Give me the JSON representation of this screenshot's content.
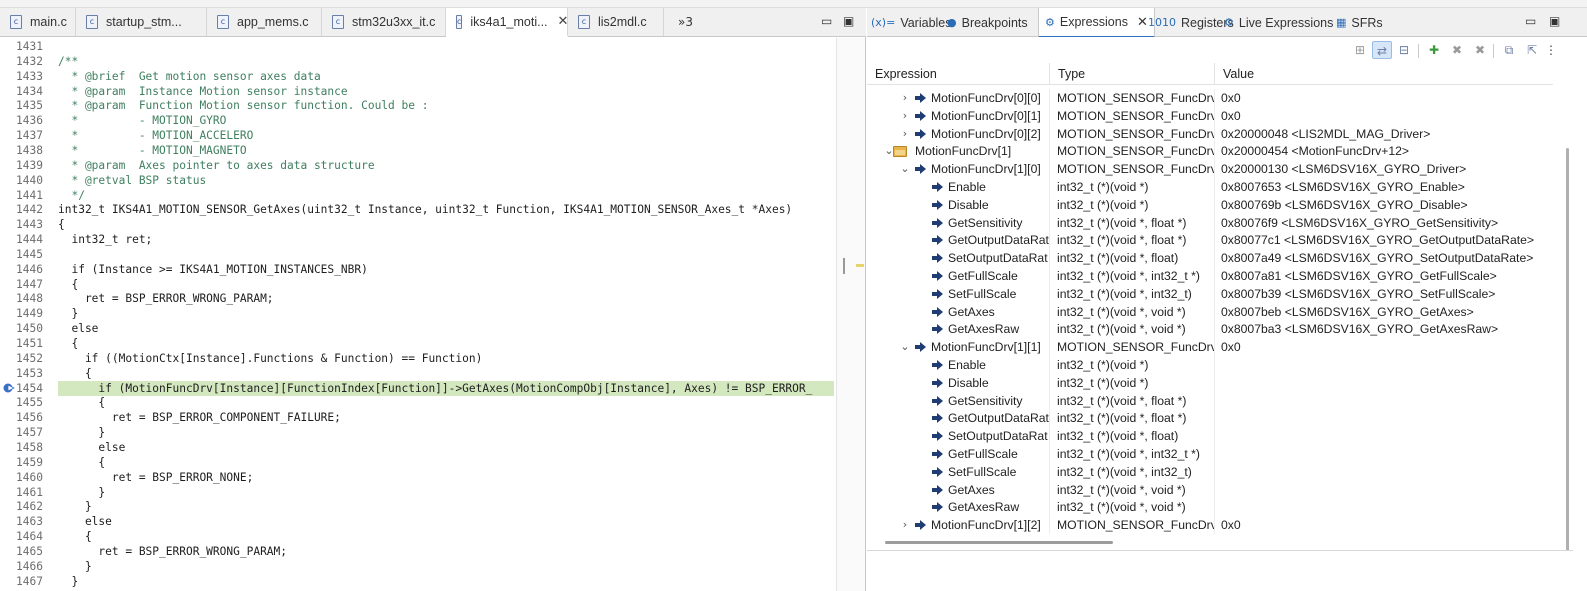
{
  "editor": {
    "tabs": [
      {
        "label": "main.c",
        "active": false
      },
      {
        "label": "startup_stm...",
        "active": false
      },
      {
        "label": "app_mems.c",
        "active": false
      },
      {
        "label": "stm32u3xx_it.c",
        "active": false
      },
      {
        "label": "iks4a1_moti...",
        "active": true,
        "close": "✕"
      },
      {
        "label": "lis2mdl.c",
        "active": false
      }
    ],
    "overflow_label": "»3",
    "minimize": "▭",
    "maximize": "▣",
    "current_line": "1454",
    "lines": [
      {
        "n": "1431",
        "text": "",
        "kind": "code"
      },
      {
        "n": "1432",
        "text": "/**",
        "kind": "comment"
      },
      {
        "n": "1433",
        "text": "  * @brief  Get motion sensor axes data",
        "kind": "comment"
      },
      {
        "n": "1434",
        "text": "  * @param  Instance Motion sensor instance",
        "kind": "comment"
      },
      {
        "n": "1435",
        "text": "  * @param  Function Motion sensor function. Could be :",
        "kind": "comment"
      },
      {
        "n": "1436",
        "text": "  *         - MOTION_GYRO",
        "kind": "comment"
      },
      {
        "n": "1437",
        "text": "  *         - MOTION_ACCELERO",
        "kind": "comment"
      },
      {
        "n": "1438",
        "text": "  *         - MOTION_MAGNETO",
        "kind": "comment"
      },
      {
        "n": "1439",
        "text": "  * @param  Axes pointer to axes data structure",
        "kind": "comment"
      },
      {
        "n": "1440",
        "text": "  * @retval BSP status",
        "kind": "comment"
      },
      {
        "n": "1441",
        "text": "  */",
        "kind": "comment"
      },
      {
        "n": "1442",
        "text": "int32_t IKS4A1_MOTION_SENSOR_GetAxes(uint32_t Instance, uint32_t Function, IKS4A1_MOTION_SENSOR_Axes_t *Axes)",
        "kind": "code"
      },
      {
        "n": "1443",
        "text": "{",
        "kind": "code"
      },
      {
        "n": "1444",
        "text": "  int32_t ret;",
        "kind": "code"
      },
      {
        "n": "1445",
        "text": "",
        "kind": "code"
      },
      {
        "n": "1446",
        "text": "  if (Instance >= IKS4A1_MOTION_INSTANCES_NBR)",
        "kind": "code"
      },
      {
        "n": "1447",
        "text": "  {",
        "kind": "code"
      },
      {
        "n": "1448",
        "text": "    ret = BSP_ERROR_WRONG_PARAM;",
        "kind": "code"
      },
      {
        "n": "1449",
        "text": "  }",
        "kind": "code"
      },
      {
        "n": "1450",
        "text": "  else",
        "kind": "code"
      },
      {
        "n": "1451",
        "text": "  {",
        "kind": "code"
      },
      {
        "n": "1452",
        "text": "    if ((MotionCtx[Instance].Functions & Function) == Function)",
        "kind": "code"
      },
      {
        "n": "1453",
        "text": "    {",
        "kind": "code"
      },
      {
        "n": "1454",
        "text": "      if (MotionFuncDrv[Instance][FunctionIndex[Function]]->GetAxes(MotionCompObj[Instance], Axes) != BSP_ERROR_",
        "kind": "current"
      },
      {
        "n": "1455",
        "text": "      {",
        "kind": "code"
      },
      {
        "n": "1456",
        "text": "        ret = BSP_ERROR_COMPONENT_FAILURE;",
        "kind": "code"
      },
      {
        "n": "1457",
        "text": "      }",
        "kind": "code"
      },
      {
        "n": "1458",
        "text": "      else",
        "kind": "code"
      },
      {
        "n": "1459",
        "text": "      {",
        "kind": "code"
      },
      {
        "n": "1460",
        "text": "        ret = BSP_ERROR_NONE;",
        "kind": "code"
      },
      {
        "n": "1461",
        "text": "      }",
        "kind": "code"
      },
      {
        "n": "1462",
        "text": "    }",
        "kind": "code"
      },
      {
        "n": "1463",
        "text": "    else",
        "kind": "code"
      },
      {
        "n": "1464",
        "text": "    {",
        "kind": "code"
      },
      {
        "n": "1465",
        "text": "      ret = BSP_ERROR_WRONG_PARAM;",
        "kind": "code"
      },
      {
        "n": "1466",
        "text": "    }",
        "kind": "code"
      },
      {
        "n": "1467",
        "text": "  }",
        "kind": "code"
      }
    ]
  },
  "views": {
    "tabs": [
      {
        "icon": "(x)=",
        "label": "Variables"
      },
      {
        "icon": "●",
        "label": "Breakpoints"
      },
      {
        "icon": "⚙",
        "label": "Expressions",
        "active": true,
        "close": "✕"
      },
      {
        "icon": "1010",
        "label": "Registers"
      },
      {
        "icon": "⚙",
        "label": "Live Expressions"
      },
      {
        "icon": "▦",
        "label": "SFRs"
      }
    ],
    "minimize": "▭",
    "maximize": "▣"
  },
  "expressions": {
    "columns": [
      "Expression",
      "Type",
      "Value"
    ],
    "rows": [
      {
        "depth": 1,
        "twisty": "›",
        "icon": "arrow",
        "name": "MotionFuncDrv[0][0]",
        "type": "MOTION_SENSOR_FuncDrv_...",
        "value": "0x0"
      },
      {
        "depth": 1,
        "twisty": "›",
        "icon": "arrow",
        "name": "MotionFuncDrv[0][1]",
        "type": "MOTION_SENSOR_FuncDrv_...",
        "value": "0x0"
      },
      {
        "depth": 1,
        "twisty": "›",
        "icon": "arrow",
        "name": "MotionFuncDrv[0][2]",
        "type": "MOTION_SENSOR_FuncDrv_...",
        "value": "0x20000048 <LIS2MDL_MAG_Driver>"
      },
      {
        "depth": 0,
        "twisty": "⌄",
        "icon": "folder",
        "name": "MotionFuncDrv[1]",
        "type": "MOTION_SENSOR_FuncDrv_...",
        "value": "0x20000454 <MotionFuncDrv+12>"
      },
      {
        "depth": 1,
        "twisty": "⌄",
        "icon": "arrow",
        "name": "MotionFuncDrv[1][0]",
        "type": "MOTION_SENSOR_FuncDrv_...",
        "value": "0x20000130 <LSM6DSV16X_GYRO_Driver>"
      },
      {
        "depth": 2,
        "twisty": "",
        "icon": "arrow",
        "name": "Enable",
        "type": "int32_t (*)(void *)",
        "value": "0x8007653 <LSM6DSV16X_GYRO_Enable>"
      },
      {
        "depth": 2,
        "twisty": "",
        "icon": "arrow",
        "name": "Disable",
        "type": "int32_t (*)(void *)",
        "value": "0x800769b <LSM6DSV16X_GYRO_Disable>"
      },
      {
        "depth": 2,
        "twisty": "",
        "icon": "arrow",
        "name": "GetSensitivity",
        "type": "int32_t (*)(void *, float *)",
        "value": "0x80076f9 <LSM6DSV16X_GYRO_GetSensitivity>"
      },
      {
        "depth": 2,
        "twisty": "",
        "icon": "arrow",
        "name": "GetOutputDataRat",
        "type": "int32_t (*)(void *, float *)",
        "value": "0x80077c1 <LSM6DSV16X_GYRO_GetOutputDataRate>"
      },
      {
        "depth": 2,
        "twisty": "",
        "icon": "arrow",
        "name": "SetOutputDataRat",
        "type": "int32_t (*)(void *, float)",
        "value": "0x8007a49 <LSM6DSV16X_GYRO_SetOutputDataRate>"
      },
      {
        "depth": 2,
        "twisty": "",
        "icon": "arrow",
        "name": "GetFullScale",
        "type": "int32_t (*)(void *, int32_t *)",
        "value": "0x8007a81 <LSM6DSV16X_GYRO_GetFullScale>"
      },
      {
        "depth": 2,
        "twisty": "",
        "icon": "arrow",
        "name": "SetFullScale",
        "type": "int32_t (*)(void *, int32_t)",
        "value": "0x8007b39 <LSM6DSV16X_GYRO_SetFullScale>"
      },
      {
        "depth": 2,
        "twisty": "",
        "icon": "arrow",
        "name": "GetAxes",
        "type": "int32_t (*)(void *, void *)",
        "value": "0x8007beb <LSM6DSV16X_GYRO_GetAxes>"
      },
      {
        "depth": 2,
        "twisty": "",
        "icon": "arrow",
        "name": "GetAxesRaw",
        "type": "int32_t (*)(void *, void *)",
        "value": "0x8007ba3 <LSM6DSV16X_GYRO_GetAxesRaw>"
      },
      {
        "depth": 1,
        "twisty": "⌄",
        "icon": "arrow",
        "name": "MotionFuncDrv[1][1]",
        "type": "MOTION_SENSOR_FuncDrv_...",
        "value": "0x0"
      },
      {
        "depth": 2,
        "twisty": "",
        "icon": "arrow",
        "name": "Enable",
        "type": "int32_t (*)(void *)",
        "value": ""
      },
      {
        "depth": 2,
        "twisty": "",
        "icon": "arrow",
        "name": "Disable",
        "type": "int32_t (*)(void *)",
        "value": ""
      },
      {
        "depth": 2,
        "twisty": "",
        "icon": "arrow",
        "name": "GetSensitivity",
        "type": "int32_t (*)(void *, float *)",
        "value": ""
      },
      {
        "depth": 2,
        "twisty": "",
        "icon": "arrow",
        "name": "GetOutputDataRat",
        "type": "int32_t (*)(void *, float *)",
        "value": ""
      },
      {
        "depth": 2,
        "twisty": "",
        "icon": "arrow",
        "name": "SetOutputDataRat",
        "type": "int32_t (*)(void *, float)",
        "value": ""
      },
      {
        "depth": 2,
        "twisty": "",
        "icon": "arrow",
        "name": "GetFullScale",
        "type": "int32_t (*)(void *, int32_t *)",
        "value": ""
      },
      {
        "depth": 2,
        "twisty": "",
        "icon": "arrow",
        "name": "SetFullScale",
        "type": "int32_t (*)(void *, int32_t)",
        "value": ""
      },
      {
        "depth": 2,
        "twisty": "",
        "icon": "arrow",
        "name": "GetAxes",
        "type": "int32_t (*)(void *, void *)",
        "value": ""
      },
      {
        "depth": 2,
        "twisty": "",
        "icon": "arrow",
        "name": "GetAxesRaw",
        "type": "int32_t (*)(void *, void *)",
        "value": ""
      },
      {
        "depth": 1,
        "twisty": "›",
        "icon": "arrow",
        "name": "MotionFuncDrv[1][2]",
        "type": "MOTION_SENSOR_FuncDrv_...",
        "value": "0x0"
      }
    ]
  },
  "colors": {
    "current_line_highlight": "#d4e8c0",
    "comment": "#3f7f5f",
    "active_view_underline": "#2f6fc0"
  }
}
